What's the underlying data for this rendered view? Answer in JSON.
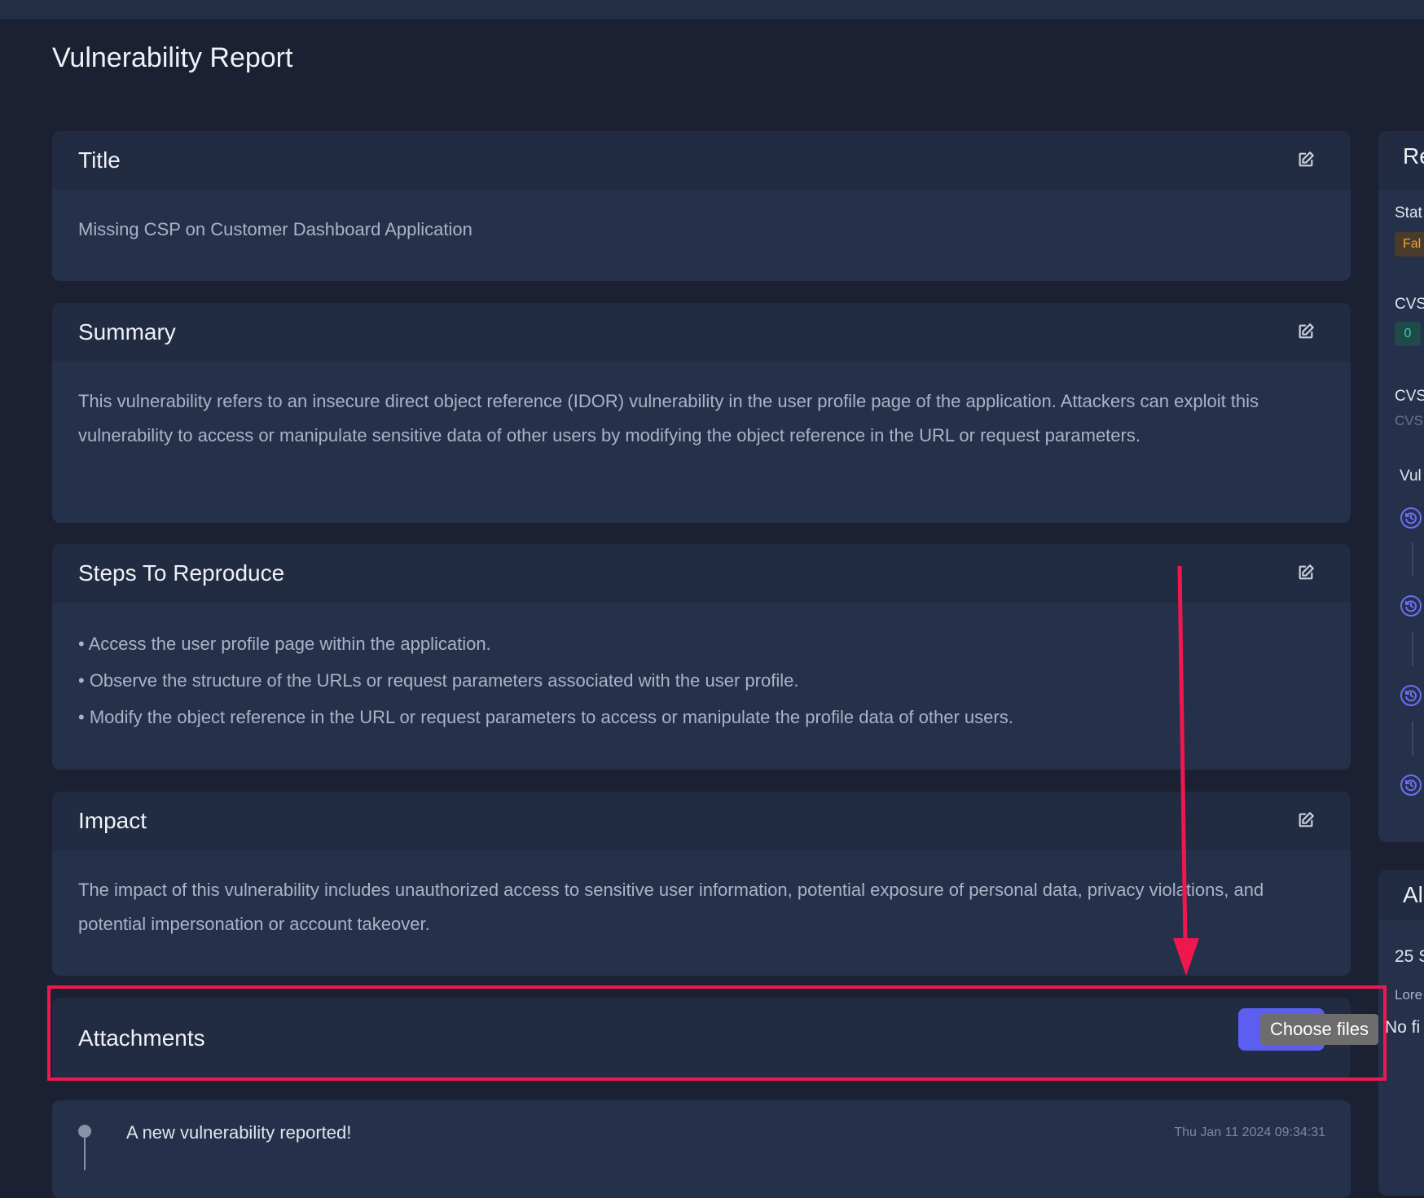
{
  "page": {
    "title": "Vulnerability Report"
  },
  "cards": {
    "title": {
      "heading": "Title",
      "text": "Missing CSP on Customer Dashboard Application"
    },
    "summary": {
      "heading": "Summary",
      "text": "This vulnerability refers to an insecure direct object reference (IDOR) vulnerability in the user profile page of the application. Attackers can exploit this vulnerability to access or manipulate sensitive data of other users by modifying the object reference in the URL or request parameters."
    },
    "steps": {
      "heading": "Steps To Reproduce",
      "items": [
        "• Access the user profile page within the application.",
        "• Observe the structure of the URLs or request parameters associated with the user profile.",
        "• Modify the object reference in the URL or request parameters to access or manipulate the profile data of other users."
      ]
    },
    "impact": {
      "heading": "Impact",
      "text": "The impact of this vulnerability includes unauthorized access to sensitive user information, potential exposure of personal data, privacy violations, and potential impersonation or account takeover."
    },
    "attachments": {
      "heading": "Attachments",
      "choose_files": "Choose files",
      "no_file": "No fi"
    }
  },
  "activity": {
    "message": "A new vulnerability reported!",
    "time": "Thu Jan 11 2024 09:34:31"
  },
  "side_panel": {
    "heading": "Re",
    "status_label": "Stat",
    "status_value": "Fal",
    "cvss_label": "CVS",
    "cvss_value": "0",
    "cvss_vector_label": "CVS",
    "cvss_vector_value": "CVS",
    "timeline_label": "Vul",
    "second_heading": "Al",
    "second_count": "25 S",
    "second_text": "Lore"
  },
  "colors": {
    "accent": "#5b5ef0",
    "highlight": "#f0174f",
    "status": "#f0a531",
    "cvss": "#2ed3a8"
  }
}
